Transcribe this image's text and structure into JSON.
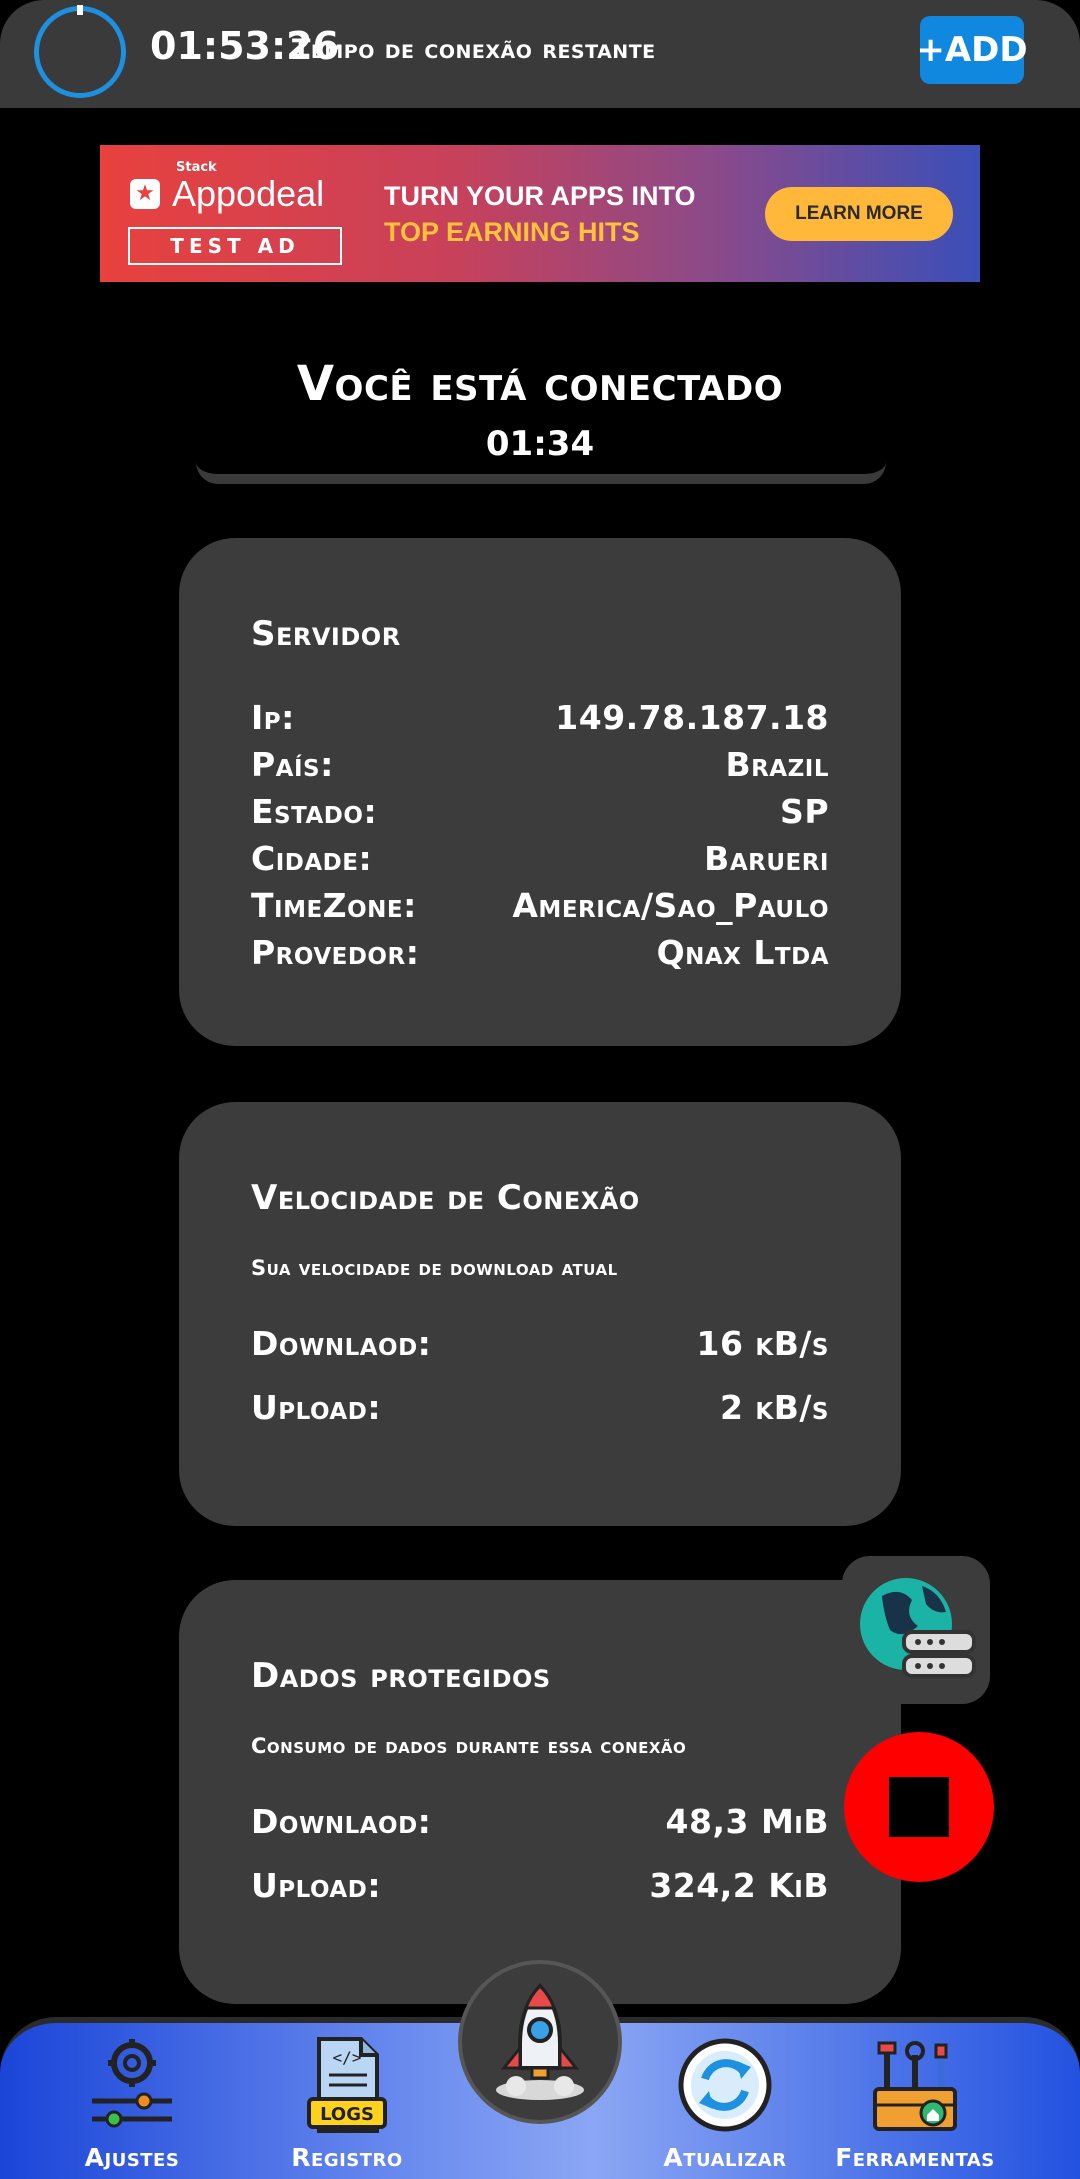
{
  "topbar": {
    "timer_time": "01:53:26",
    "timer_label": "Tempo de conexão restante",
    "add_label": "+ADD",
    "accent": "#1e90e0"
  },
  "ad": {
    "small_label": "Stack",
    "brand": "Appodeal",
    "test_label": "TEST AD",
    "line1": "TURN YOUR APPS INTO",
    "line2": "TOP EARNING HITS",
    "cta": "LEARN MORE"
  },
  "status": {
    "title": "Você está conectado",
    "elapsed": "01:34"
  },
  "server": {
    "title": "Servidor",
    "rows": [
      {
        "label": "Ip:",
        "value": "149.78.187.18"
      },
      {
        "label": "País:",
        "value": "Brazil"
      },
      {
        "label": "Estado:",
        "value": "SP"
      },
      {
        "label": "Cidade:",
        "value": "Barueri"
      },
      {
        "label": "TimeZone:",
        "value": "America/Sao_Paulo"
      },
      {
        "label": "Provedor:",
        "value": "Qnax Ltda"
      }
    ]
  },
  "speed": {
    "title": "Velocidade de Conexão",
    "subtitle": "Sua velocidade de download atual",
    "rows": [
      {
        "label": "Downlaod:",
        "value": "16 kB/s"
      },
      {
        "label": "Upload:",
        "value": "2 kB/s"
      }
    ]
  },
  "data_usage": {
    "title": "Dados protegidos",
    "subtitle": "Consumo de dados durante essa conexão",
    "rows": [
      {
        "label": "Downlaod:",
        "value": "48,3 MiB"
      },
      {
        "label": "Upload:",
        "value": "324,2 KiB"
      }
    ]
  },
  "fabs": {
    "server_icon": "globe-server-icon",
    "stop_icon": "stop-icon",
    "stop_color": "#ff0000"
  },
  "nav": {
    "ajustes": "Ajustes",
    "registro": "Registro",
    "logs_badge": "LOGS",
    "atualizar": "Atualizar",
    "ferramentas": "Ferramentas",
    "center_icon": "rocket-icon"
  }
}
